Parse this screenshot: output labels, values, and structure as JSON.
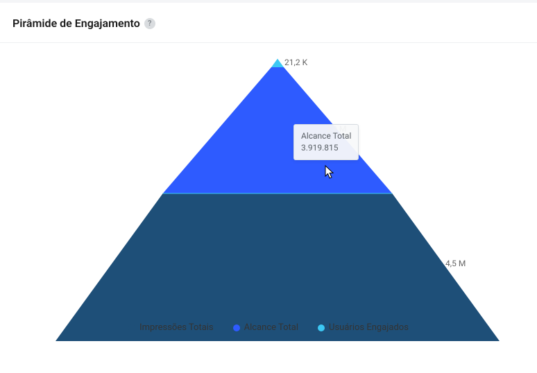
{
  "header": {
    "title": "Pirâmide de Engajamento",
    "help_icon": "?"
  },
  "labels": {
    "top": "21,2 K",
    "mid": "3,9 M",
    "bottom": "4,5 M"
  },
  "tooltip": {
    "line1": "Alcance Total",
    "line2": "3.919.815"
  },
  "legend": {
    "items": [
      {
        "label": "Impressões Totais",
        "color": "#1e4f78"
      },
      {
        "label": "Alcance Total",
        "color": "#2e5bff"
      },
      {
        "label": "Usuários Engajados",
        "color": "#3cc8f4"
      }
    ]
  },
  "colors": {
    "bottom": "#1e4f78",
    "middle": "#2e5bff",
    "top": "#3cc8f4",
    "divider": "#3cc8f4"
  },
  "chart_data": {
    "type": "pyramid",
    "title": "Pirâmide de Engajamento",
    "series": [
      {
        "name": "Impressões Totais",
        "value": 4500000,
        "display": "4,5 M"
      },
      {
        "name": "Alcance Total",
        "value": 3919815,
        "display": "3,9 M"
      },
      {
        "name": "Usuários Engajados",
        "value": 21200,
        "display": "21,2 K"
      }
    ]
  }
}
